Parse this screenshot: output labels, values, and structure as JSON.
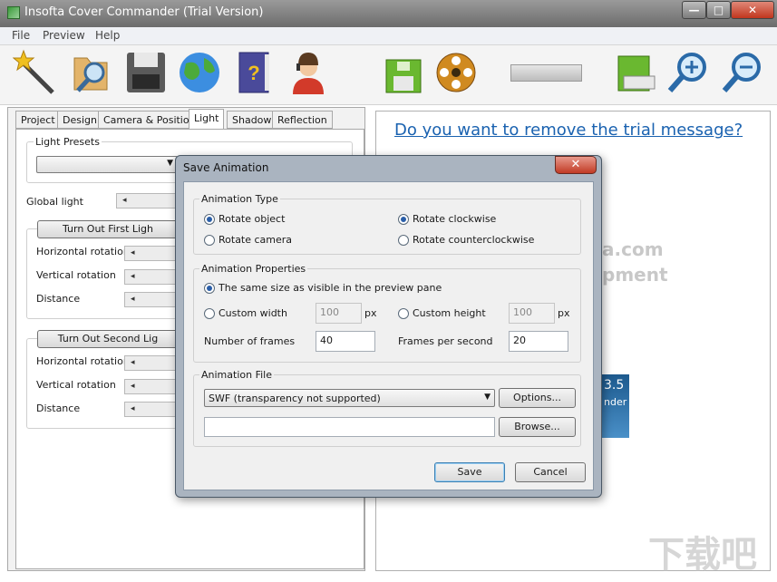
{
  "window": {
    "title": "Insofta Cover Commander (Trial Version)",
    "minimize": "—",
    "maximize": "□",
    "close": "✕"
  },
  "menu": [
    "File",
    "Preview",
    "Help"
  ],
  "toolbar": {
    "icons": [
      "wizard-icon",
      "open-icon",
      "save-icon",
      "web-icon",
      "help-book-icon",
      "support-icon",
      "save-image-icon",
      "save-animation-icon",
      "save-render-icon",
      "zoom-in-icon",
      "zoom-out-icon"
    ]
  },
  "tabs": [
    "Project",
    "Design",
    "Camera & Position",
    "Light",
    "Shadow",
    "Reflection"
  ],
  "light": {
    "presets_label": "Light Presets",
    "global_light": "Global light",
    "first_light_button": "Turn Out First Ligh",
    "second_light_button": "Turn Out Second Lig",
    "horizontal_rotation": "Horizontal rotation",
    "vertical_rotation": "Vertical rotation",
    "distance": "Distance"
  },
  "preview": {
    "trial_message": "Do you want to remove the trial message?",
    "watermark1": "a.com",
    "watermark2": "pment",
    "cover_text1": "3.5",
    "cover_text2": "nder",
    "site_watermark": "下载吧"
  },
  "dialog": {
    "title": "Save Animation",
    "close": "✕",
    "animation_type": {
      "heading": "Animation Type",
      "rotate_object": "Rotate object",
      "rotate_camera": "Rotate camera",
      "rotate_clockwise": "Rotate clockwise",
      "rotate_counterclockwise": "Rotate counterclockwise"
    },
    "animation_properties": {
      "heading": "Animation Properties",
      "same_size": "The same size as visible in the preview pane",
      "custom_width": "Custom width",
      "custom_width_value": "100",
      "custom_height": "Custom height",
      "custom_height_value": "100",
      "px": "px",
      "frames_label": "Number of frames",
      "frames_value": "40",
      "fps_label": "Frames per second",
      "fps_value": "20"
    },
    "animation_file": {
      "heading": "Animation File",
      "format": "SWF (transparency not supported)",
      "options_button": "Options...",
      "browse_button": "Browse...",
      "path": ""
    },
    "save_button": "Save",
    "cancel_button": "Cancel"
  }
}
